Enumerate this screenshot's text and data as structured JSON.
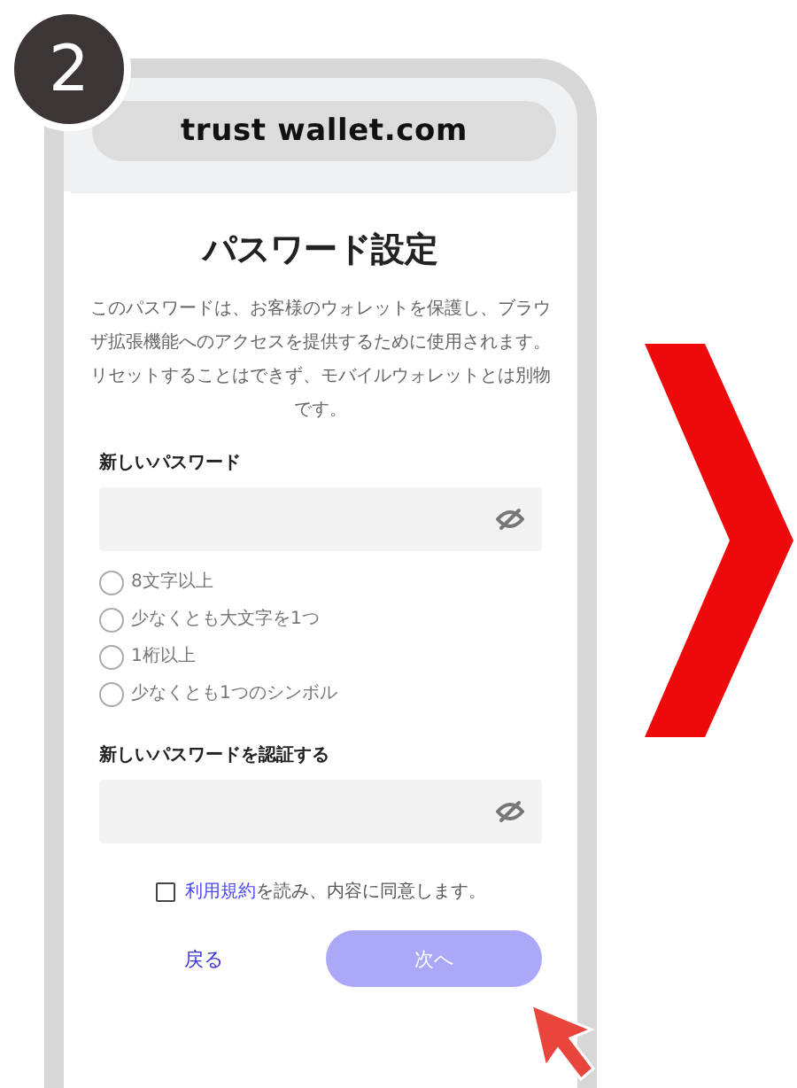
{
  "step": {
    "number": "2"
  },
  "address_bar": {
    "url": "trust wallet.com"
  },
  "page": {
    "title": "パスワード設定",
    "description": "このパスワードは、お客様のウォレットを保護し、ブラウザ拡張機能へのアクセスを提供するために使用されます。リセットすることはできず、モバイルウォレットとは別物です。",
    "new_password": {
      "label": "新しいパスワード"
    },
    "requirements": [
      {
        "label": "8文字以上",
        "checked": false
      },
      {
        "label": "少なくとも大文字を1つ",
        "checked": false
      },
      {
        "label": "1桁以上",
        "checked": false
      },
      {
        "label": "少なくとも1つのシンボル",
        "checked": false
      }
    ],
    "confirm_password": {
      "label": "新しいパスワードを認証する"
    },
    "terms": {
      "checked": false,
      "link": "利用規約",
      "text": "を読み、内容に同意します。"
    },
    "back_button": {
      "label": "戻る"
    },
    "next_button": {
      "label": "次へ",
      "disabled": true
    }
  }
}
